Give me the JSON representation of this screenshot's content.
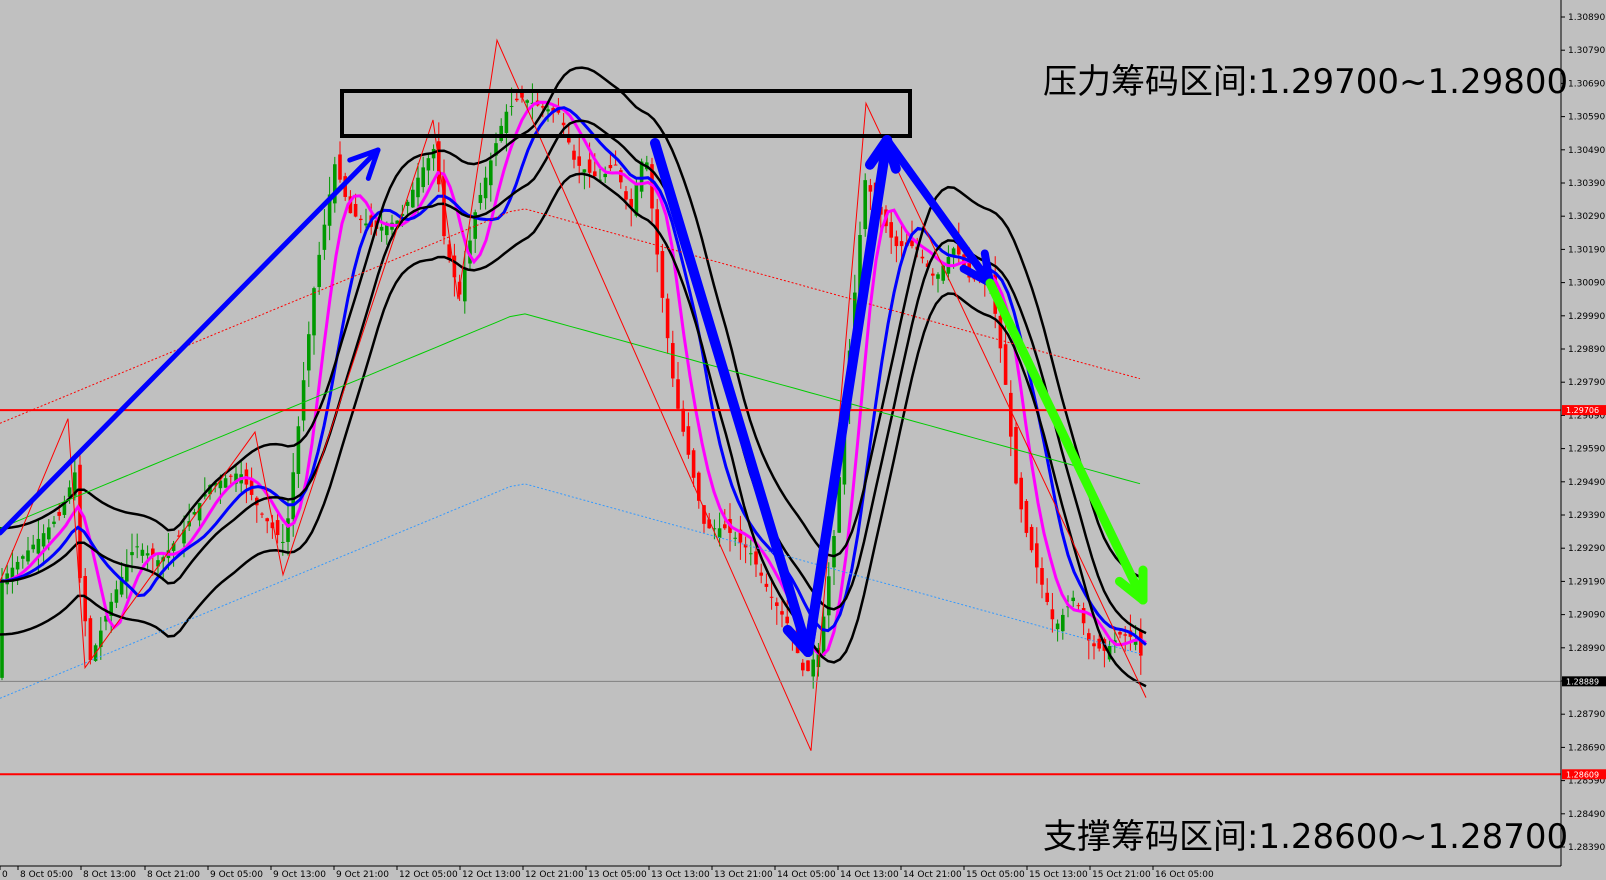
{
  "chart_data": {
    "type": "candlestick",
    "y_axis": {
      "range": [
        1.2835,
        1.3095
      ],
      "tick_labels": [
        "1.30890",
        "1.30790",
        "1.30690",
        "1.30590",
        "1.30490",
        "1.30390",
        "1.30290",
        "1.30190",
        "1.30090",
        "1.29990",
        "1.29890",
        "1.29790",
        "1.29690",
        "1.29590",
        "1.29490",
        "1.29390",
        "1.29290",
        "1.29190",
        "1.29090",
        "1.28990",
        "1.28890",
        "1.28790",
        "1.28690",
        "1.28590",
        "1.28490",
        "1.28390"
      ],
      "tick_values": [
        1.3089,
        1.3079,
        1.3069,
        1.3059,
        1.3049,
        1.3039,
        1.3029,
        1.3019,
        1.3009,
        1.2999,
        1.2989,
        1.2979,
        1.2969,
        1.2959,
        1.2949,
        1.2939,
        1.2929,
        1.2919,
        1.2909,
        1.2899,
        1.2889,
        1.2879,
        1.2869,
        1.2859,
        1.2849,
        1.2839
      ]
    },
    "x_axis": {
      "tick_labels": [
        "0",
        "8 Oct 05:00",
        "8 Oct 13:00",
        "8 Oct 21:00",
        "9 Oct 05:00",
        "9 Oct 13:00",
        "9 Oct 21:00",
        "12 Oct 05:00",
        "12 Oct 13:00",
        "12 Oct 21:00",
        "13 Oct 05:00",
        "13 Oct 13:00",
        "13 Oct 21:00",
        "14 Oct 05:00",
        "14 Oct 13:00",
        "14 Oct 21:00",
        "15 Oct 05:00",
        "15 Oct 13:00",
        "15 Oct 21:00",
        "16 Oct 05:00"
      ]
    },
    "horizontal_levels": [
      {
        "value": 1.29706,
        "label": "1.29706",
        "color": "#ff0000"
      },
      {
        "value": 1.28609,
        "label": "1.28609",
        "color": "#ff0000"
      }
    ],
    "current_price": {
      "value": 1.28889,
      "label": "1.28889"
    },
    "annotations": {
      "resistance": "压力筹码区间:1.29700~1.29800",
      "support": "支撑筹码区间:1.28600~1.28700"
    },
    "colors": {
      "background": "#c0c0c0",
      "bull_candle": "#009900",
      "bear_candle": "#ff0000",
      "bollinger": "#000000",
      "ma_fast": "#ff00ff",
      "ma_slow": "#0000ff",
      "ma_long": "#00cc00",
      "envelope_upper": "#ff0000",
      "envelope_lower": "#3399ff",
      "arrow_main": "#0000ff",
      "arrow_down": "#33ff00",
      "level_line": "#ff0000",
      "box": "#000000"
    }
  }
}
